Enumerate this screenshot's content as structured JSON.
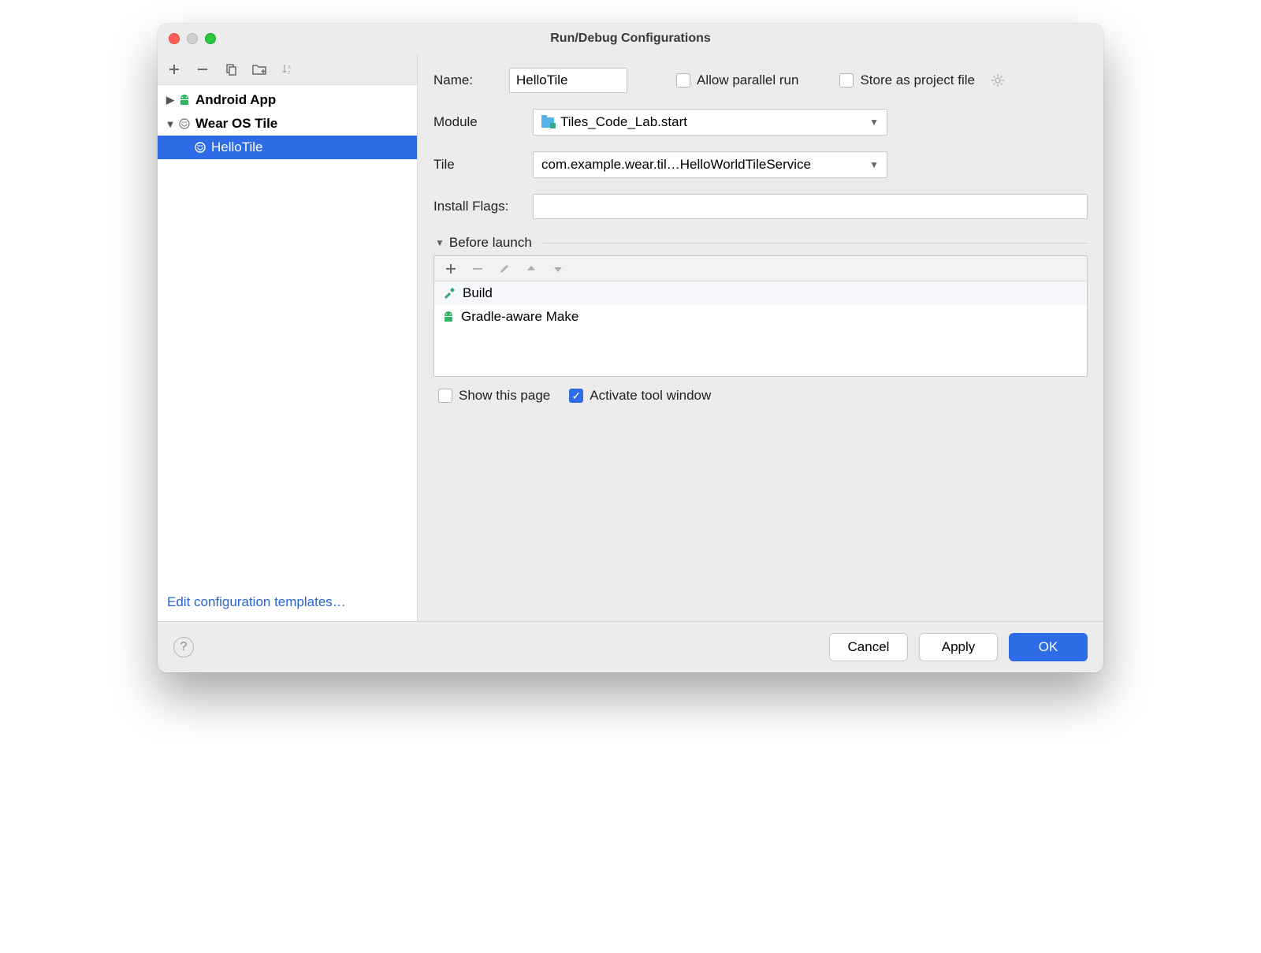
{
  "window": {
    "title": "Run/Debug Configurations"
  },
  "sidebar": {
    "tree": [
      {
        "label": "Android App",
        "icon": "android",
        "expanded": false,
        "depth": 0,
        "bold": true
      },
      {
        "label": "Wear OS Tile",
        "icon": "wear",
        "expanded": true,
        "depth": 0,
        "bold": true
      },
      {
        "label": "HelloTile",
        "icon": "wear",
        "depth": 1,
        "selected": true
      }
    ],
    "edit_templates": "Edit configuration templates…"
  },
  "form": {
    "name_label": "Name:",
    "name_value": "HelloTile",
    "allow_parallel": {
      "label": "Allow parallel run",
      "checked": false
    },
    "store_project": {
      "label": "Store as project file",
      "checked": false
    },
    "module_label": "Module",
    "module_value": "Tiles_Code_Lab.start",
    "tile_label": "Tile",
    "tile_value": "com.example.wear.til…HelloWorldTileService",
    "flags_label": "Install Flags:",
    "flags_value": "",
    "before_launch": {
      "title": "Before launch",
      "items": [
        {
          "icon": "hammer",
          "label": "Build"
        },
        {
          "icon": "android",
          "label": "Gradle-aware Make"
        }
      ]
    },
    "show_page": {
      "label": "Show this page",
      "checked": false
    },
    "activate_tool": {
      "label": "Activate tool window",
      "checked": true
    }
  },
  "footer": {
    "cancel": "Cancel",
    "apply": "Apply",
    "ok": "OK"
  }
}
